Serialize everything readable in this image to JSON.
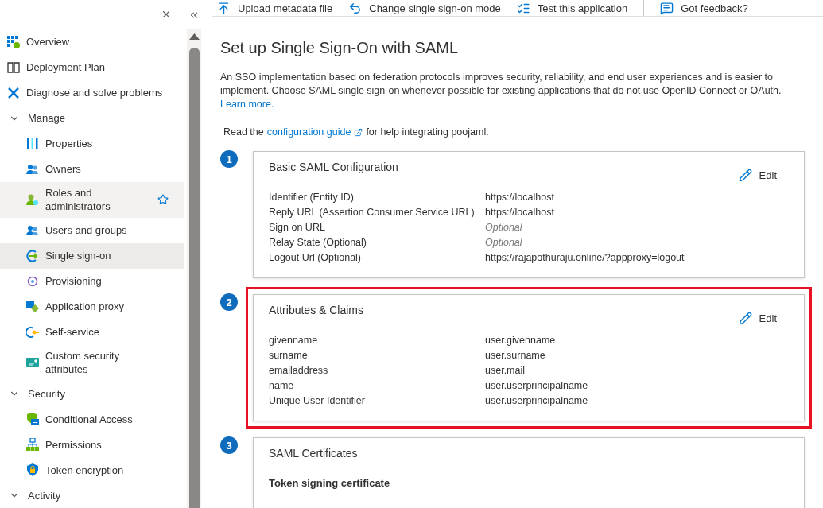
{
  "sidebar": {
    "items": [
      {
        "kind": "link",
        "label": "Overview",
        "selected": false,
        "hovered": false
      },
      {
        "kind": "link",
        "label": "Deployment Plan",
        "selected": false,
        "hovered": false
      },
      {
        "kind": "link",
        "label": "Diagnose and solve problems",
        "selected": false,
        "hovered": false
      },
      {
        "kind": "group",
        "label": "Manage",
        "expanded": true,
        "children": [
          {
            "label": "Properties",
            "selected": false,
            "hovered": false
          },
          {
            "label": "Owners",
            "selected": false,
            "hovered": false
          },
          {
            "label": "Roles and administrators",
            "selected": false,
            "hovered": true
          },
          {
            "label": "Users and groups",
            "selected": false,
            "hovered": false
          },
          {
            "label": "Single sign-on",
            "selected": true,
            "hovered": false
          },
          {
            "label": "Provisioning",
            "selected": false,
            "hovered": false
          },
          {
            "label": "Application proxy",
            "selected": false,
            "hovered": false
          },
          {
            "label": "Self-service",
            "selected": false,
            "hovered": false
          },
          {
            "label": "Custom security attributes",
            "selected": false,
            "hovered": false
          }
        ]
      },
      {
        "kind": "group",
        "label": "Security",
        "expanded": true,
        "children": [
          {
            "label": "Conditional Access",
            "selected": false,
            "hovered": false
          },
          {
            "label": "Permissions",
            "selected": false,
            "hovered": false
          },
          {
            "label": "Token encryption",
            "selected": false,
            "hovered": false
          }
        ]
      },
      {
        "kind": "group",
        "label": "Activity",
        "expanded": true
      }
    ]
  },
  "toolbar": [
    {
      "label": "Upload metadata file"
    },
    {
      "label": "Change single sign-on mode"
    },
    {
      "label": "Test this application"
    },
    {
      "label": "Got feedback?"
    }
  ],
  "title": "Set up Single Sign-On with SAML",
  "intro": {
    "text": "An SSO implementation based on federation protocols improves security, reliability, and end user experiences and is easier to implement. Choose SAML single sign-on whenever possible for existing applications that do not use OpenID Connect or OAuth.",
    "link": "Learn more."
  },
  "guide": {
    "before": "Read the",
    "link": "configuration guide",
    "after": "for help integrating poojaml."
  },
  "steps": [
    {
      "number": "1",
      "title": "Basic SAML Configuration",
      "edit": "Edit",
      "highlighted": false,
      "rows": [
        {
          "label": "Identifier (Entity ID)",
          "value": "https://localhost"
        },
        {
          "label": "Reply URL (Assertion Consumer Service URL)",
          "value": "https://localhost"
        },
        {
          "label": "Sign on URL",
          "placeholder": "Optional"
        },
        {
          "label": "Relay State (Optional)",
          "placeholder": "Optional"
        },
        {
          "label": "Logout Url (Optional)",
          "value": "https://rajapothuraju.online/?appproxy=logout"
        }
      ]
    },
    {
      "number": "2",
      "title": "Attributes & Claims",
      "edit": "Edit",
      "highlighted": true,
      "rows": [
        {
          "label": "givenname",
          "value": "user.givenname"
        },
        {
          "label": "surname",
          "value": "user.surname"
        },
        {
          "label": "emailaddress",
          "value": "user.mail"
        },
        {
          "label": "name",
          "value": "user.userprincipalname"
        },
        {
          "label": "Unique User Identifier",
          "value": "user.userprincipalname"
        }
      ]
    },
    {
      "number": "3",
      "title": "SAML Certificates",
      "subtitle": "Token signing certificate",
      "highlighted": false
    }
  ]
}
